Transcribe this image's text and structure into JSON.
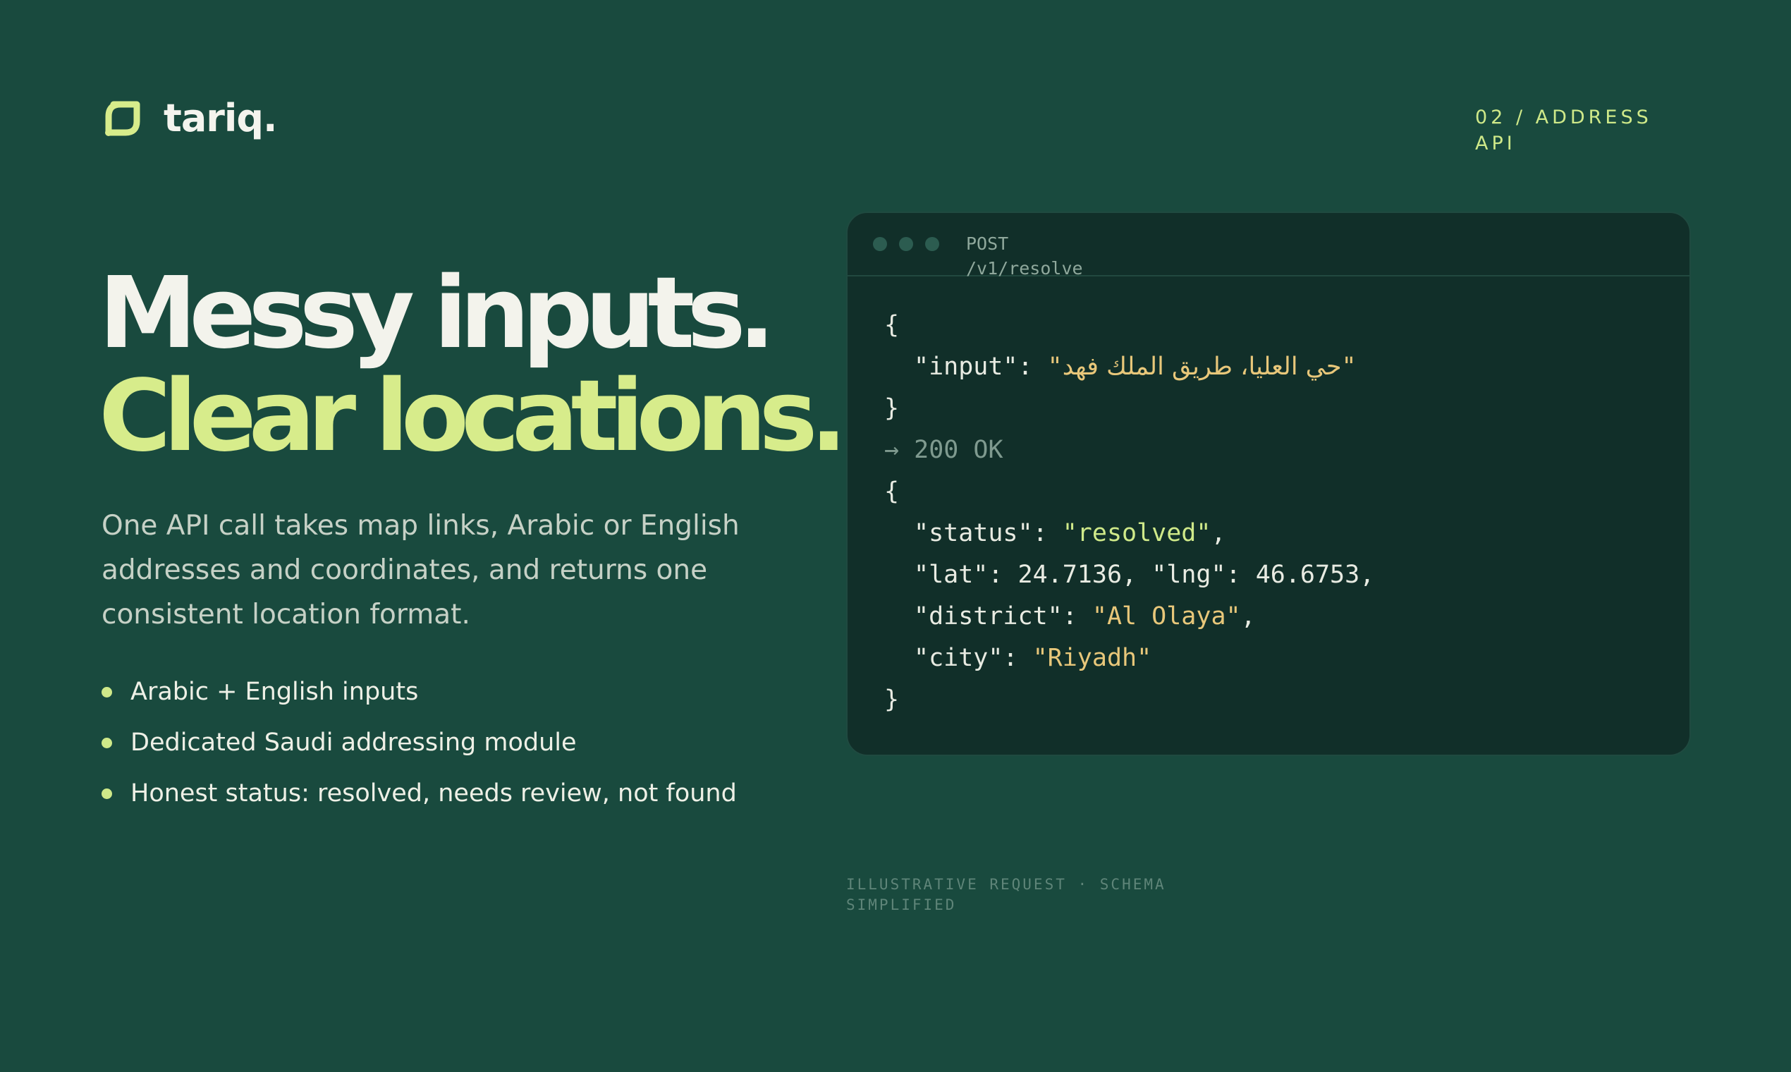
{
  "brand": {
    "name": "tariq.",
    "accent_color": "#d7ec8b",
    "background_color": "#194a3e"
  },
  "section_label": "02 / ADDRESS API",
  "headline": {
    "line1": "Messy inputs.",
    "line2": "Clear locations."
  },
  "lede": "One API call takes map links, Arabic or English addresses and coordinates, and returns one consistent location format.",
  "features": [
    "Arabic + English inputs",
    "Dedicated Saudi addressing module",
    "Honest status: resolved, needs review, not found"
  ],
  "code_window": {
    "method": "POST",
    "path": "/v1/resolve",
    "request": {
      "open_brace": "{",
      "input_key": "\"input\"",
      "input_value": "حي العليا، طريق الملك فهد",
      "close_brace": "}"
    },
    "response_status": "→ 200 OK",
    "response": {
      "open_brace": "{",
      "status_key": "\"status\"",
      "status_value": "\"resolved\"",
      "lat_key": "\"lat\"",
      "lat_value": "24.7136",
      "lng_key": "\"lng\"",
      "lng_value": "46.6753",
      "district_key": "\"district\"",
      "district_value": "\"Al Olaya\"",
      "city_key": "\"city\"",
      "city_value": "\"Riyadh\"",
      "close_brace": "}"
    }
  },
  "footnote": "ILLUSTRATIVE REQUEST · SCHEMA SIMPLIFIED"
}
